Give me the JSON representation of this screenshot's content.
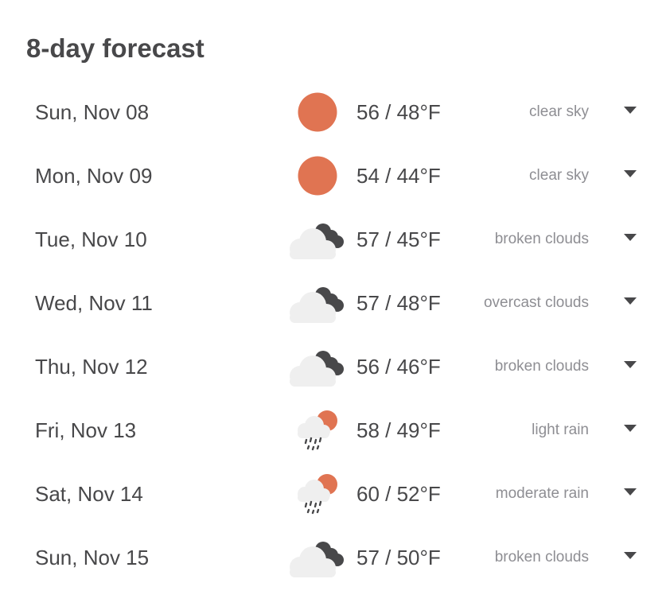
{
  "forecast": {
    "title": "8-day forecast",
    "colors": {
      "sun": "#e07452",
      "cloud_light": "#efefef",
      "cloud_dark": "#48484a",
      "text": "#48484a",
      "muted": "#8e8e93"
    },
    "days": [
      {
        "date": "Sun, Nov 08",
        "temp": "56 / 48°F",
        "description": "clear sky",
        "icon": "clear-sky-icon"
      },
      {
        "date": "Mon, Nov 09",
        "temp": "54 / 44°F",
        "description": "clear sky",
        "icon": "clear-sky-icon"
      },
      {
        "date": "Tue, Nov 10",
        "temp": "57 / 45°F",
        "description": "broken clouds",
        "icon": "clouds-icon"
      },
      {
        "date": "Wed, Nov 11",
        "temp": "57 / 48°F",
        "description": "overcast clouds",
        "icon": "clouds-icon"
      },
      {
        "date": "Thu, Nov 12",
        "temp": "56 / 46°F",
        "description": "broken clouds",
        "icon": "clouds-icon"
      },
      {
        "date": "Fri, Nov 13",
        "temp": "58 / 49°F",
        "description": "light rain",
        "icon": "rain-icon"
      },
      {
        "date": "Sat, Nov 14",
        "temp": "60 / 52°F",
        "description": "moderate rain",
        "icon": "rain-icon"
      },
      {
        "date": "Sun, Nov 15",
        "temp": "57 / 50°F",
        "description": "broken clouds",
        "icon": "clouds-icon"
      }
    ]
  }
}
